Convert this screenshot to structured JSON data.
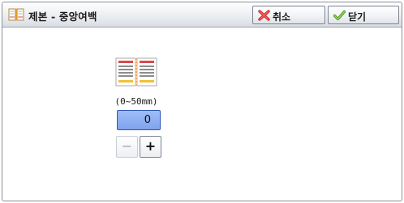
{
  "window": {
    "title": "제본 - 중앙여백",
    "title_icon": "book-icon"
  },
  "header_buttons": {
    "cancel": {
      "label": "취소",
      "icon": "red-x-icon"
    },
    "close": {
      "label": "닫기",
      "icon": "checkmark-icon"
    }
  },
  "margin": {
    "illustration": "open-book-icon",
    "range_label": "(0~50mm)",
    "value": "0",
    "minus_label": "−",
    "plus_label": "+",
    "minus_enabled": false
  },
  "colors": {
    "field_fill": "#8fb0f2",
    "field_border": "#2e55b8",
    "cancel_icon": "#d62020",
    "close_icon": "#6cbf2a"
  }
}
